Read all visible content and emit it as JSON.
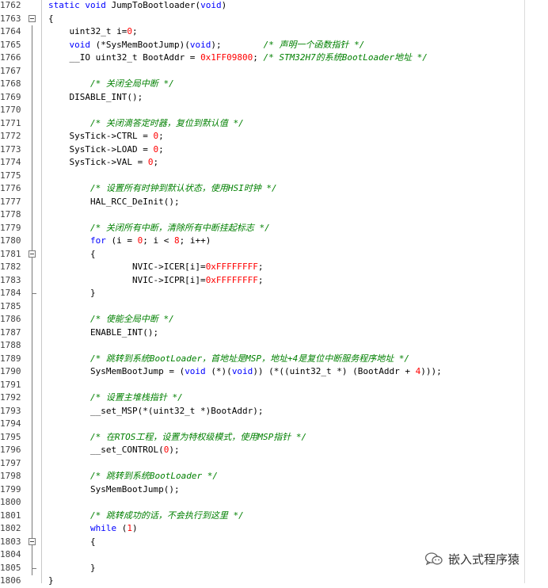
{
  "editor": {
    "lines": [
      {
        "n": "1762",
        "fold": "none",
        "segs": [
          [
            "kw",
            "static "
          ],
          [
            "kw",
            "void "
          ],
          [
            "t",
            "JumpToBootloader("
          ],
          [
            "kw",
            "void"
          ],
          [
            "t",
            ")"
          ]
        ]
      },
      {
        "n": "1763",
        "fold": "open",
        "segs": [
          [
            "t",
            "{"
          ]
        ]
      },
      {
        "n": "1764",
        "fold": "bar",
        "segs": [
          [
            "t",
            "    uint32_t i="
          ],
          [
            "num",
            "0"
          ],
          [
            "t",
            ";"
          ]
        ]
      },
      {
        "n": "1765",
        "fold": "bar",
        "segs": [
          [
            "t",
            "    "
          ],
          [
            "kw",
            "void "
          ],
          [
            "t",
            "(*SysMemBootJump)("
          ],
          [
            "kw",
            "void"
          ],
          [
            "t",
            ");        "
          ],
          [
            "cm",
            "/* 声明一个函数指针 */"
          ]
        ]
      },
      {
        "n": "1766",
        "fold": "bar",
        "segs": [
          [
            "t",
            "    __IO uint32_t BootAddr = "
          ],
          [
            "num",
            "0x1FF09800"
          ],
          [
            "t",
            "; "
          ],
          [
            "cm",
            "/* STM32H7的系统BootLoader地址 */"
          ]
        ]
      },
      {
        "n": "1767",
        "fold": "bar",
        "segs": []
      },
      {
        "n": "1768",
        "fold": "bar",
        "segs": [
          [
            "t",
            "        "
          ],
          [
            "cm",
            "/* 关闭全局中断 */"
          ]
        ]
      },
      {
        "n": "1769",
        "fold": "bar",
        "segs": [
          [
            "t",
            "    DISABLE_INT();"
          ]
        ]
      },
      {
        "n": "1770",
        "fold": "bar",
        "segs": []
      },
      {
        "n": "1771",
        "fold": "bar",
        "segs": [
          [
            "t",
            "        "
          ],
          [
            "cm",
            "/* 关闭滴答定时器，复位到默认值 */"
          ]
        ]
      },
      {
        "n": "1772",
        "fold": "bar",
        "segs": [
          [
            "t",
            "    SysTick->CTRL = "
          ],
          [
            "num",
            "0"
          ],
          [
            "t",
            ";"
          ]
        ]
      },
      {
        "n": "1773",
        "fold": "bar",
        "segs": [
          [
            "t",
            "    SysTick->LOAD = "
          ],
          [
            "num",
            "0"
          ],
          [
            "t",
            ";"
          ]
        ]
      },
      {
        "n": "1774",
        "fold": "bar",
        "segs": [
          [
            "t",
            "    SysTick->VAL = "
          ],
          [
            "num",
            "0"
          ],
          [
            "t",
            ";"
          ]
        ]
      },
      {
        "n": "1775",
        "fold": "bar",
        "segs": []
      },
      {
        "n": "1776",
        "fold": "bar",
        "segs": [
          [
            "t",
            "        "
          ],
          [
            "cm",
            "/* 设置所有时钟到默认状态，使用HSI时钟 */"
          ]
        ]
      },
      {
        "n": "1777",
        "fold": "bar",
        "segs": [
          [
            "t",
            "        HAL_RCC_DeInit();"
          ]
        ]
      },
      {
        "n": "1778",
        "fold": "bar",
        "segs": []
      },
      {
        "n": "1779",
        "fold": "bar",
        "segs": [
          [
            "t",
            "        "
          ],
          [
            "cm",
            "/* 关闭所有中断，清除所有中断挂起标志 */"
          ]
        ]
      },
      {
        "n": "1780",
        "fold": "bar",
        "segs": [
          [
            "t",
            "        "
          ],
          [
            "kw",
            "for "
          ],
          [
            "t",
            "(i = "
          ],
          [
            "num",
            "0"
          ],
          [
            "t",
            "; i < "
          ],
          [
            "num",
            "8"
          ],
          [
            "t",
            "; i++)"
          ]
        ]
      },
      {
        "n": "1781",
        "fold": "open",
        "segs": [
          [
            "t",
            "        {"
          ]
        ]
      },
      {
        "n": "1782",
        "fold": "bar",
        "segs": [
          [
            "t",
            "                NVIC->ICER[i]="
          ],
          [
            "num",
            "0xFFFFFFFF"
          ],
          [
            "t",
            ";"
          ]
        ]
      },
      {
        "n": "1783",
        "fold": "bar",
        "segs": [
          [
            "t",
            "                NVIC->ICPR[i]="
          ],
          [
            "num",
            "0xFFFFFFFF"
          ],
          [
            "t",
            ";"
          ]
        ]
      },
      {
        "n": "1784",
        "fold": "end",
        "segs": [
          [
            "t",
            "        }"
          ]
        ]
      },
      {
        "n": "1785",
        "fold": "bar",
        "segs": []
      },
      {
        "n": "1786",
        "fold": "bar",
        "segs": [
          [
            "t",
            "        "
          ],
          [
            "cm",
            "/* 使能全局中断 */"
          ]
        ]
      },
      {
        "n": "1787",
        "fold": "bar",
        "segs": [
          [
            "t",
            "        ENABLE_INT();"
          ]
        ]
      },
      {
        "n": "1788",
        "fold": "bar",
        "segs": []
      },
      {
        "n": "1789",
        "fold": "bar",
        "segs": [
          [
            "t",
            "        "
          ],
          [
            "cm",
            "/* 跳转到系统BootLoader，首地址是MSP，地址+4是复位中断服务程序地址 */"
          ]
        ]
      },
      {
        "n": "1790",
        "fold": "bar",
        "segs": [
          [
            "t",
            "        SysMemBootJump = ("
          ],
          [
            "kw",
            "void "
          ],
          [
            "t",
            "(*)("
          ],
          [
            "kw",
            "void"
          ],
          [
            "t",
            ")) (*((uint32_t *) (BootAddr + "
          ],
          [
            "num",
            "4"
          ],
          [
            "t",
            ")));"
          ]
        ]
      },
      {
        "n": "1791",
        "fold": "bar",
        "segs": []
      },
      {
        "n": "1792",
        "fold": "bar",
        "segs": [
          [
            "t",
            "        "
          ],
          [
            "cm",
            "/* 设置主堆栈指针 */"
          ]
        ]
      },
      {
        "n": "1793",
        "fold": "bar",
        "segs": [
          [
            "t",
            "        __set_MSP(*(uint32_t *)BootAddr);"
          ]
        ]
      },
      {
        "n": "1794",
        "fold": "bar",
        "segs": []
      },
      {
        "n": "1795",
        "fold": "bar",
        "segs": [
          [
            "t",
            "        "
          ],
          [
            "cm",
            "/* 在RTOS工程，设置为特权级模式，使用MSP指针 */"
          ]
        ]
      },
      {
        "n": "1796",
        "fold": "bar",
        "segs": [
          [
            "t",
            "        __set_CONTROL("
          ],
          [
            "num",
            "0"
          ],
          [
            "t",
            ");"
          ]
        ]
      },
      {
        "n": "1797",
        "fold": "bar",
        "segs": []
      },
      {
        "n": "1798",
        "fold": "bar",
        "segs": [
          [
            "t",
            "        "
          ],
          [
            "cm",
            "/* 跳转到系统BootLoader */"
          ]
        ]
      },
      {
        "n": "1799",
        "fold": "bar",
        "segs": [
          [
            "t",
            "        SysMemBootJump();"
          ]
        ]
      },
      {
        "n": "1800",
        "fold": "bar",
        "segs": []
      },
      {
        "n": "1801",
        "fold": "bar",
        "segs": [
          [
            "t",
            "        "
          ],
          [
            "cm",
            "/* 跳转成功的话，不会执行到这里 */"
          ]
        ]
      },
      {
        "n": "1802",
        "fold": "bar",
        "segs": [
          [
            "t",
            "        "
          ],
          [
            "kw",
            "while "
          ],
          [
            "t",
            "("
          ],
          [
            "num",
            "1"
          ],
          [
            "t",
            ")"
          ]
        ]
      },
      {
        "n": "1803",
        "fold": "open",
        "segs": [
          [
            "t",
            "        {"
          ]
        ]
      },
      {
        "n": "1804",
        "fold": "bar",
        "segs": []
      },
      {
        "n": "1805",
        "fold": "end",
        "segs": [
          [
            "t",
            "        }"
          ]
        ]
      },
      {
        "n": "1806",
        "fold": "none",
        "segs": [
          [
            "t",
            "}"
          ]
        ]
      }
    ]
  },
  "watermark": {
    "text": "嵌入式程序猿",
    "icon": "wechat-icon"
  },
  "colors": {
    "keyword": "#0000ff",
    "number": "#ff0000",
    "comment": "#008000",
    "text": "#000000"
  }
}
